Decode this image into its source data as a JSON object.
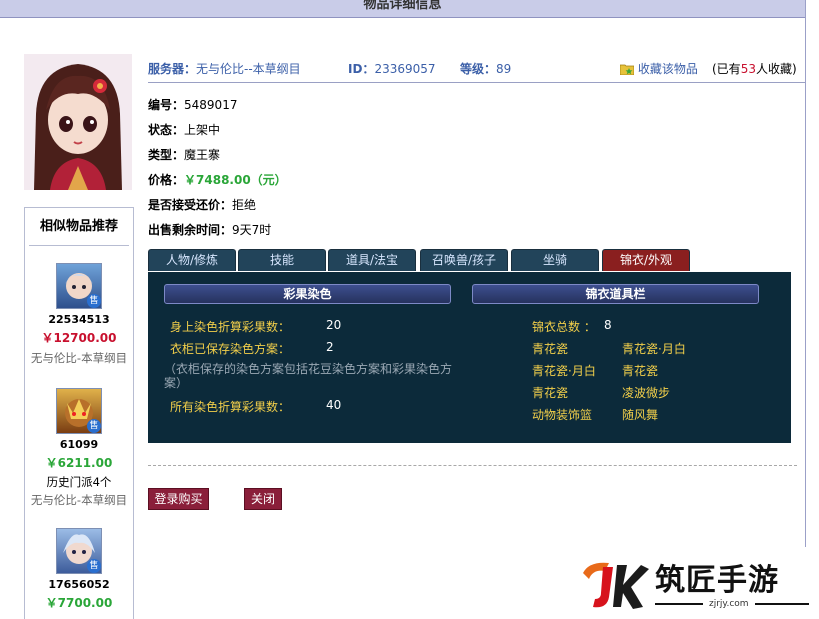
{
  "page_title": "物品详细信息",
  "header": {
    "server_label": "服务器：",
    "server_value": "无与伦比--本草纲目",
    "id_label": "ID：",
    "id_value": "23369057",
    "level_label": "等级：",
    "level_value": "89",
    "favorite_label": "收藏该物品",
    "favorite_count_prefix": "(已有",
    "favorite_count": "53",
    "favorite_count_suffix": "人收藏)"
  },
  "details": {
    "number_label": "编号：",
    "number_value": "5489017",
    "status_label": "状态：",
    "status_value": "上架中",
    "type_label": "类型：",
    "type_value": "魔王寨",
    "price_label": "价格：",
    "price_value": "￥7488.00（元）",
    "counter_label": "是否接受还价：",
    "counter_value": "拒绝",
    "remaining_label": "出售剩余时间：",
    "remaining_value": "9天7时"
  },
  "tabs": [
    {
      "label": "人物/修炼"
    },
    {
      "label": "技能"
    },
    {
      "label": "道具/法宝"
    },
    {
      "label": "召唤兽/孩子"
    },
    {
      "label": "坐骑"
    },
    {
      "label": "锦衣/外观"
    }
  ],
  "dye_panel": {
    "title": "彩果染色",
    "rows": [
      {
        "label": "身上染色折算彩果数：",
        "value": "20"
      },
      {
        "label": "衣柜已保存染色方案：",
        "value": "2"
      }
    ],
    "note": "（衣柜保存的染色方案包括花豆染色方案和彩果染色方案）",
    "total_label": "所有染色折算彩果数：",
    "total_value": "40"
  },
  "wardrobe_panel": {
    "title": "锦衣道具栏",
    "total_label": "锦衣总数 ：",
    "total_value": "8",
    "items": [
      [
        "青花瓷",
        "青花瓷·月白"
      ],
      [
        "青花瓷·月白",
        "青花瓷"
      ],
      [
        "青花瓷",
        "凌波微步"
      ],
      [
        "动物装饰篮",
        "随风舞"
      ]
    ]
  },
  "buttons": {
    "buy": "登录购买",
    "close": "关闭"
  },
  "sidebar": {
    "title": "相似物品推荐",
    "sell_badge": "售",
    "items": [
      {
        "id": "22534513",
        "price": "￥12700.00",
        "server": "无与伦比-本草纲目",
        "extra": ""
      },
      {
        "id": "61099",
        "price": "￥6211.00",
        "server": "无与伦比-本草纲目",
        "extra": "历史门派4个"
      },
      {
        "id": "17656052",
        "price": "￥7700.00",
        "server": "",
        "extra": ""
      }
    ]
  },
  "watermark": {
    "brand": "筑匠手游",
    "url": "zjrjy.com"
  },
  "colors": {
    "accent_blue": "#3b5fa8",
    "price_green": "#2aa638",
    "price_red": "#c8102e",
    "panel_bg": "#0c2a3a",
    "tab_active": "#8a1f1f",
    "button_bg": "#8a1f3a"
  }
}
